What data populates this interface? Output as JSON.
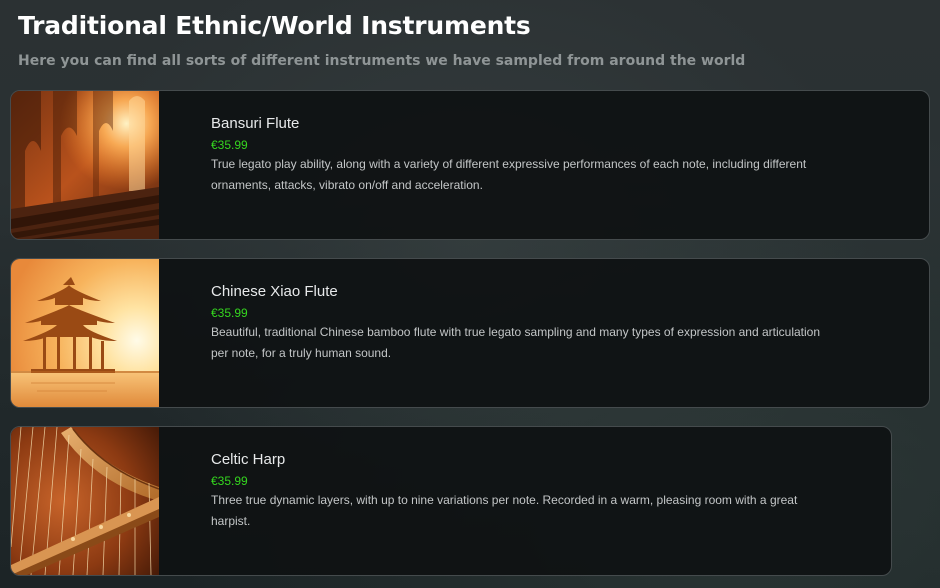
{
  "header": {
    "title": "Traditional Ethnic/World Instruments",
    "subtitle": "Here you can find all sorts of different instruments we have sampled from around the world"
  },
  "products": [
    {
      "name": "Bansuri Flute",
      "price": "€35.99",
      "description": "True legato play ability, along with a variety of different expressive performances of each note, including different ornaments, attacks, vibrato on/off and acceleration.",
      "image_icon": "indian-palace-sunlight-image"
    },
    {
      "name": "Chinese Xiao Flute",
      "price": "€35.99",
      "description": "Beautiful, traditional Chinese bamboo flute with true legato sampling and many types of expression and articulation per note, for a truly human sound.",
      "image_icon": "chinese-pagoda-sunset-image"
    },
    {
      "name": "Celtic Harp",
      "price": "€35.99",
      "description": "Three true dynamic layers, with up to nine variations per note. Recorded in a warm, pleasing room with a great harpist.",
      "image_icon": "harp-strings-image"
    }
  ],
  "colors": {
    "price": "#35d61f",
    "title": "#ffffff",
    "subtitle": "#8f9596",
    "card_background": "#0f1213",
    "card_border": "#454b4d"
  }
}
